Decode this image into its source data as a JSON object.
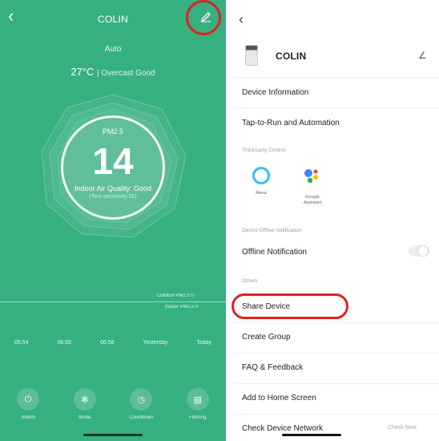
{
  "left": {
    "title": "COLIN",
    "mode": "Auto",
    "weather_temp": "27°C",
    "weather_rest": "| Overcast  Good",
    "pm_label": "PM2.5",
    "pm_value": "14",
    "quality": "Indoor Air Quality: Good",
    "quality_sub": "(Test sensitivity 00)",
    "legend_outdoor": "Outdoor PM2.5 0",
    "legend_indoor": "Indoor PM2.5 0",
    "times": [
      "06:54",
      "06:55",
      "06:56",
      "Yesterday",
      "Today"
    ],
    "controls": [
      {
        "label": "Switch",
        "icon": "power-icon"
      },
      {
        "label": "Mode",
        "icon": "fan-icon"
      },
      {
        "label": "Countdown",
        "icon": "timer-icon"
      },
      {
        "label": "Filtering",
        "icon": "filter-icon"
      }
    ],
    "colors": {
      "background": "#37b07f",
      "highlight": "#e02222"
    }
  },
  "right": {
    "device_name": "COLIN",
    "items": {
      "device_info": "Device Information",
      "tap_to_run": "Tap-to-Run and Automation",
      "third_party": "Third-party Control",
      "offline_section": "Device Offline Notification",
      "offline_notification": "Offline Notification",
      "others": "Others",
      "share_device": "Share Device",
      "create_group": "Create Group",
      "faq": "FAQ & Feedback",
      "add_home": "Add to Home Screen",
      "check_network": "Check Device Network",
      "check_now": "Check Now"
    },
    "assistants": [
      {
        "name": "Alexa"
      },
      {
        "name": "Google Assistant"
      }
    ],
    "offline_toggle": "off"
  }
}
